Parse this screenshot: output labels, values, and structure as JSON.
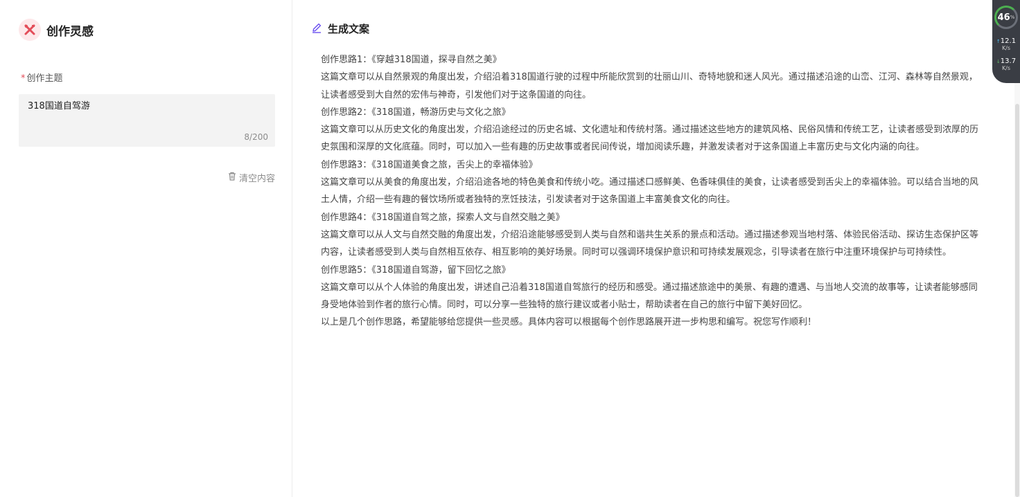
{
  "sidebar": {
    "title": "创作灵感",
    "field_label": "创作主题",
    "required_mark": "*",
    "topic_value": "318国道自驾游",
    "char_count": "8/200",
    "clear_label": "清空内容"
  },
  "result": {
    "title": "生成文案",
    "paragraphs": [
      "创作思路1：《穿越318国道，探寻自然之美》",
      "这篇文章可以从自然景观的角度出发，介绍沿着318国道行驶的过程中所能欣赏到的壮丽山川、奇特地貌和迷人风光。通过描述沿途的山峦、江河、森林等自然景观，让读者感受到大自然的宏伟与神奇，引发他们对于这条国道的向往。",
      "创作思路2：《318国道，畅游历史与文化之旅》",
      "这篇文章可以从历史文化的角度出发，介绍沿途经过的历史名城、文化遗址和传统村落。通过描述这些地方的建筑风格、民俗风情和传统工艺，让读者感受到浓厚的历史氛围和深厚的文化底蕴。同时，可以加入一些有趣的历史故事或者民间传说，增加阅读乐趣，并激发读者对于这条国道上丰富历史与文化内涵的向往。",
      "创作思路3：《318国道美食之旅，舌尖上的幸福体验》",
      "这篇文章可以从美食的角度出发，介绍沿途各地的特色美食和传统小吃。通过描述口感鲜美、色香味俱佳的美食，让读者感受到舌尖上的幸福体验。可以结合当地的风土人情，介绍一些有趣的餐饮场所或者独特的烹饪技法，引发读者对于这条国道上丰富美食文化的向往。",
      "创作思路4：《318国道自驾之旅，探索人文与自然交融之美》",
      "这篇文章可以从人文与自然交融的角度出发，介绍沿途能够感受到人类与自然和谐共生关系的景点和活动。通过描述参观当地村落、体验民俗活动、探访生态保护区等内容，让读者感受到人类与自然相互依存、相互影响的美好场景。同时可以强调环境保护意识和可持续发展观念，引导读者在旅行中注重环境保护与可持续性。",
      "创作思路5：《318国道自驾游，留下回忆之旅》",
      "这篇文章可以从个人体验的角度出发，讲述自己沿着318国道自驾旅行的经历和感受。通过描述旅途中的美景、有趣的遭遇、与当地人交流的故事等，让读者能够感同身受地体验到作者的旅行心情。同时，可以分享一些独特的旅行建议或者小贴士，帮助读者在自己的旅行中留下美好回忆。",
      "以上是几个创作思路，希望能够给您提供一些灵感。具体内容可以根据每个创作思路展开进一步构思和编写。祝您写作顺利！"
    ]
  },
  "net_widget": {
    "percent": "46",
    "percent_unit": "%",
    "upload": "12.1",
    "upload_unit": "K/s",
    "download": "13.7",
    "download_unit": "K/s",
    "upload_arrow": "↑",
    "download_arrow": "↓"
  },
  "colors": {
    "brand_red": "#e34d59",
    "accent_purple": "#6a4ff0",
    "underline": "#c9c1f7"
  },
  "icons": {
    "brand": "tools-icon",
    "clear": "trash-icon",
    "edit": "pencil-icon"
  }
}
